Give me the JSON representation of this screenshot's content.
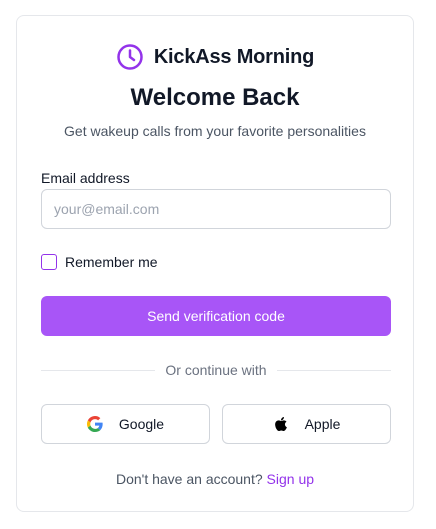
{
  "brand": {
    "name": "KickAss Morning",
    "icon": "clock-icon",
    "accent_color": "#9333ea"
  },
  "heading": {
    "title": "Welcome Back",
    "subtitle": "Get wakeup calls from your favorite personalities"
  },
  "form": {
    "email_label": "Email address",
    "email_value": "",
    "email_placeholder": "your@email.com",
    "remember_label": "Remember me",
    "remember_checked": false,
    "submit_label": "Send verification code",
    "submit_color": "#a855f7"
  },
  "divider": {
    "text": "Or continue with"
  },
  "social": {
    "google_label": "Google",
    "google_icon": "google-icon",
    "apple_label": "Apple",
    "apple_icon": "apple-icon"
  },
  "footer": {
    "prompt": "Don't have an account?",
    "link_label": "Sign up"
  }
}
